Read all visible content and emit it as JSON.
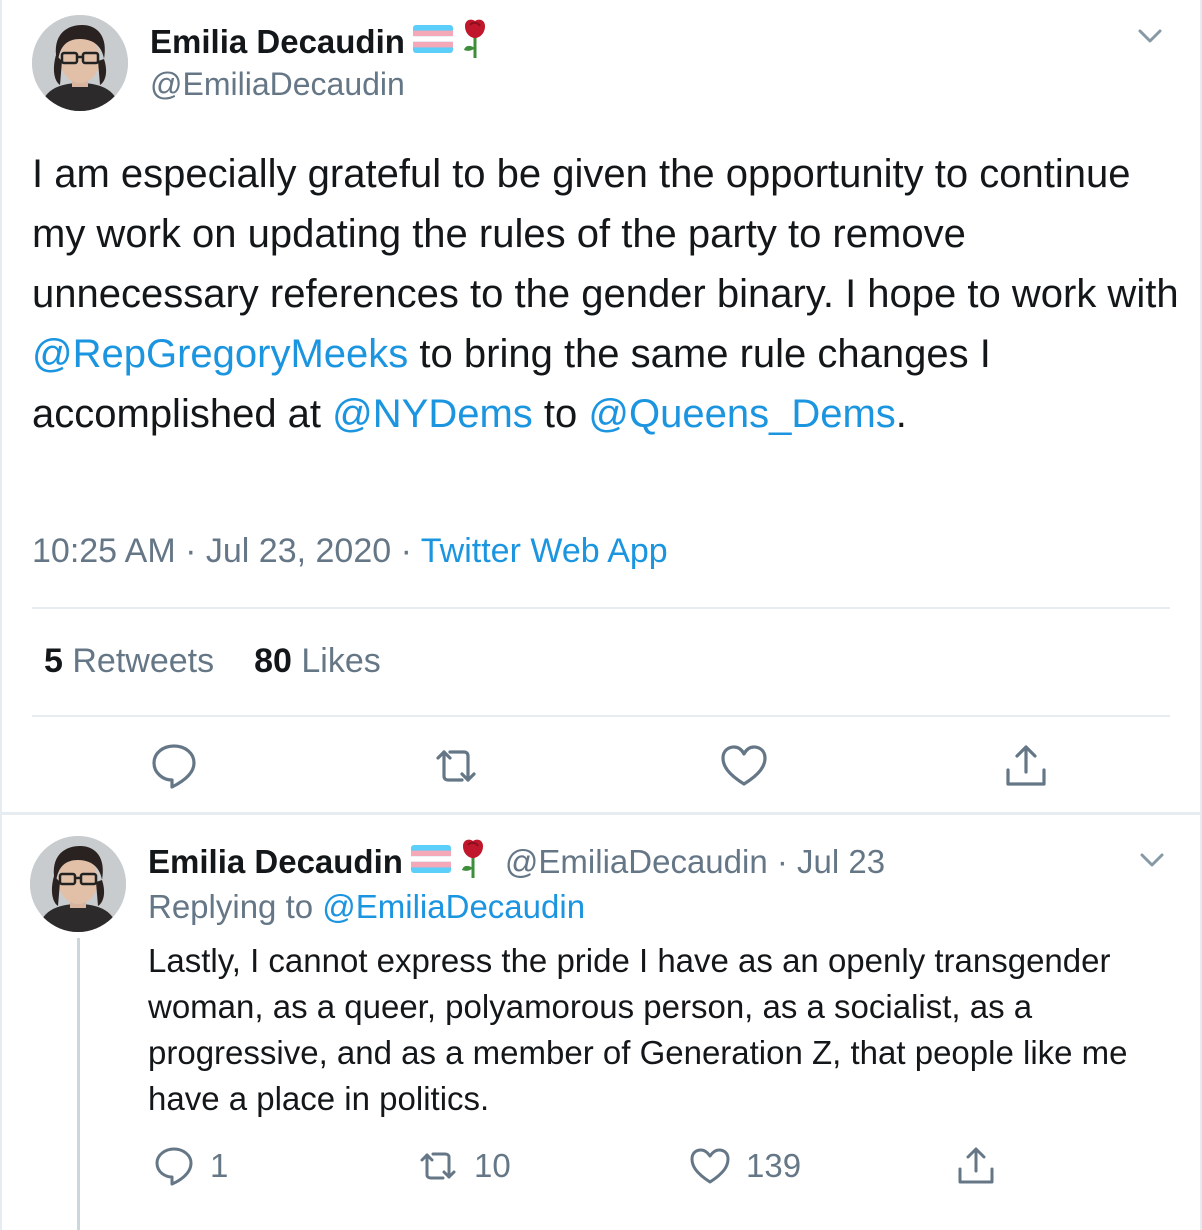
{
  "main_tweet": {
    "display_name": "Emilia Decaudin",
    "handle": "@EmiliaDecaudin",
    "text_segments": [
      {
        "text": "I am especially grateful to be given the opportunity to continue my work on updating the rules of the party to remove unnecessary references to the gender binary. I hope to work with ",
        "mention": false
      },
      {
        "text": "@RepGregoryMeeks",
        "mention": true
      },
      {
        "text": " to bring the same rule changes I accomplished at ",
        "mention": false
      },
      {
        "text": "@NYDems",
        "mention": true
      },
      {
        "text": " to ",
        "mention": false
      },
      {
        "text": "@Queens_Dems",
        "mention": true
      },
      {
        "text": ".",
        "mention": false
      }
    ],
    "time": "10:25 AM",
    "date": "Jul 23, 2020",
    "source": "Twitter Web App",
    "retweets_count": "5",
    "retweets_label": "Retweets",
    "likes_count": "80",
    "likes_label": "Likes"
  },
  "reply_tweet": {
    "display_name": "Emilia Decaudin",
    "handle_date": "@EmiliaDecaudin · Jul 23",
    "replying_to_prefix": "Replying to ",
    "replying_to_handle": "@EmiliaDecaudin",
    "text": "Lastly, I cannot express the pride I have as an openly transgender woman, as a queer, polyamorous person, as a socialist, as a progressive, and as a member of Generation Z, that people like me have a place in politics.",
    "reply_count": "1",
    "retweet_count": "10",
    "like_count": "139"
  },
  "icons": {
    "name_emojis": [
      "transgender-flag-icon",
      "rose-icon"
    ],
    "actions": [
      "reply-icon",
      "retweet-icon",
      "like-icon",
      "share-icon"
    ],
    "menu": "chevron-down-icon"
  },
  "colors": {
    "link": "#1b95e0",
    "secondary_text": "#657786",
    "primary_text": "#14171a",
    "divider": "#e6ecf0"
  }
}
